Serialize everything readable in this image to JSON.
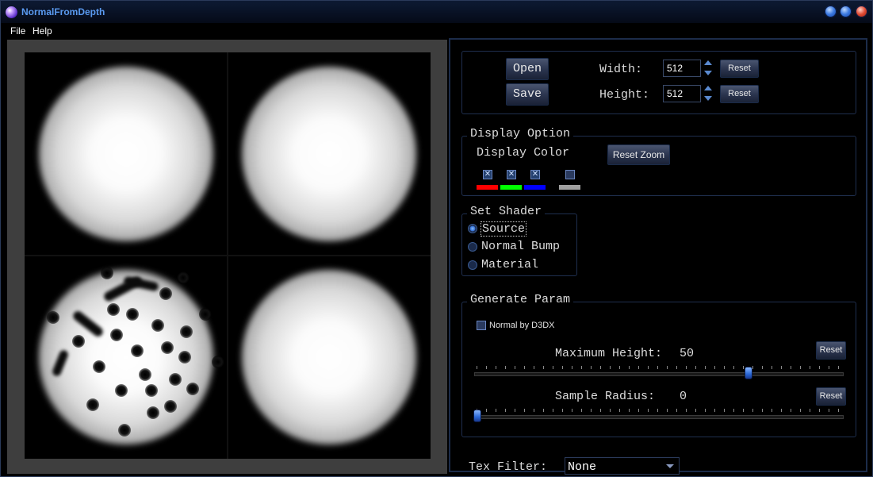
{
  "window": {
    "title": "NormalFromDepth"
  },
  "menu": {
    "items": [
      "File",
      "Help"
    ]
  },
  "size": {
    "open_label": "Open",
    "save_label": "Save",
    "width_label": "Width:",
    "width_value": "512",
    "height_label": "Height:",
    "height_value": "512",
    "reset_label": "Reset"
  },
  "display": {
    "group_title": "Display Option",
    "color_label": "Display Color",
    "reset_zoom_label": "Reset Zoom",
    "channels": [
      {
        "name": "red",
        "checked": true,
        "color": "#ff0000"
      },
      {
        "name": "green",
        "checked": true,
        "color": "#00ff00"
      },
      {
        "name": "blue",
        "checked": true,
        "color": "#0000ff"
      },
      {
        "name": "alpha",
        "checked": false,
        "color": "#a0a0a0"
      }
    ],
    "check_mark": "✕"
  },
  "shader": {
    "group_title": "Set Shader",
    "options": [
      "Source",
      "Normal Bump",
      "Material"
    ],
    "selected": "Source"
  },
  "generate": {
    "group_title": "Generate Param",
    "normal_d3dx_label": "Normal by D3DX",
    "normal_d3dx_checked": false,
    "max_height_label": "Maximum Height:",
    "max_height_value": "50",
    "sample_radius_label": "Sample Radius:",
    "sample_radius_value": "0",
    "reset_label": "Reset"
  },
  "tex_filter": {
    "label": "Tex Filter:",
    "value": "None"
  }
}
